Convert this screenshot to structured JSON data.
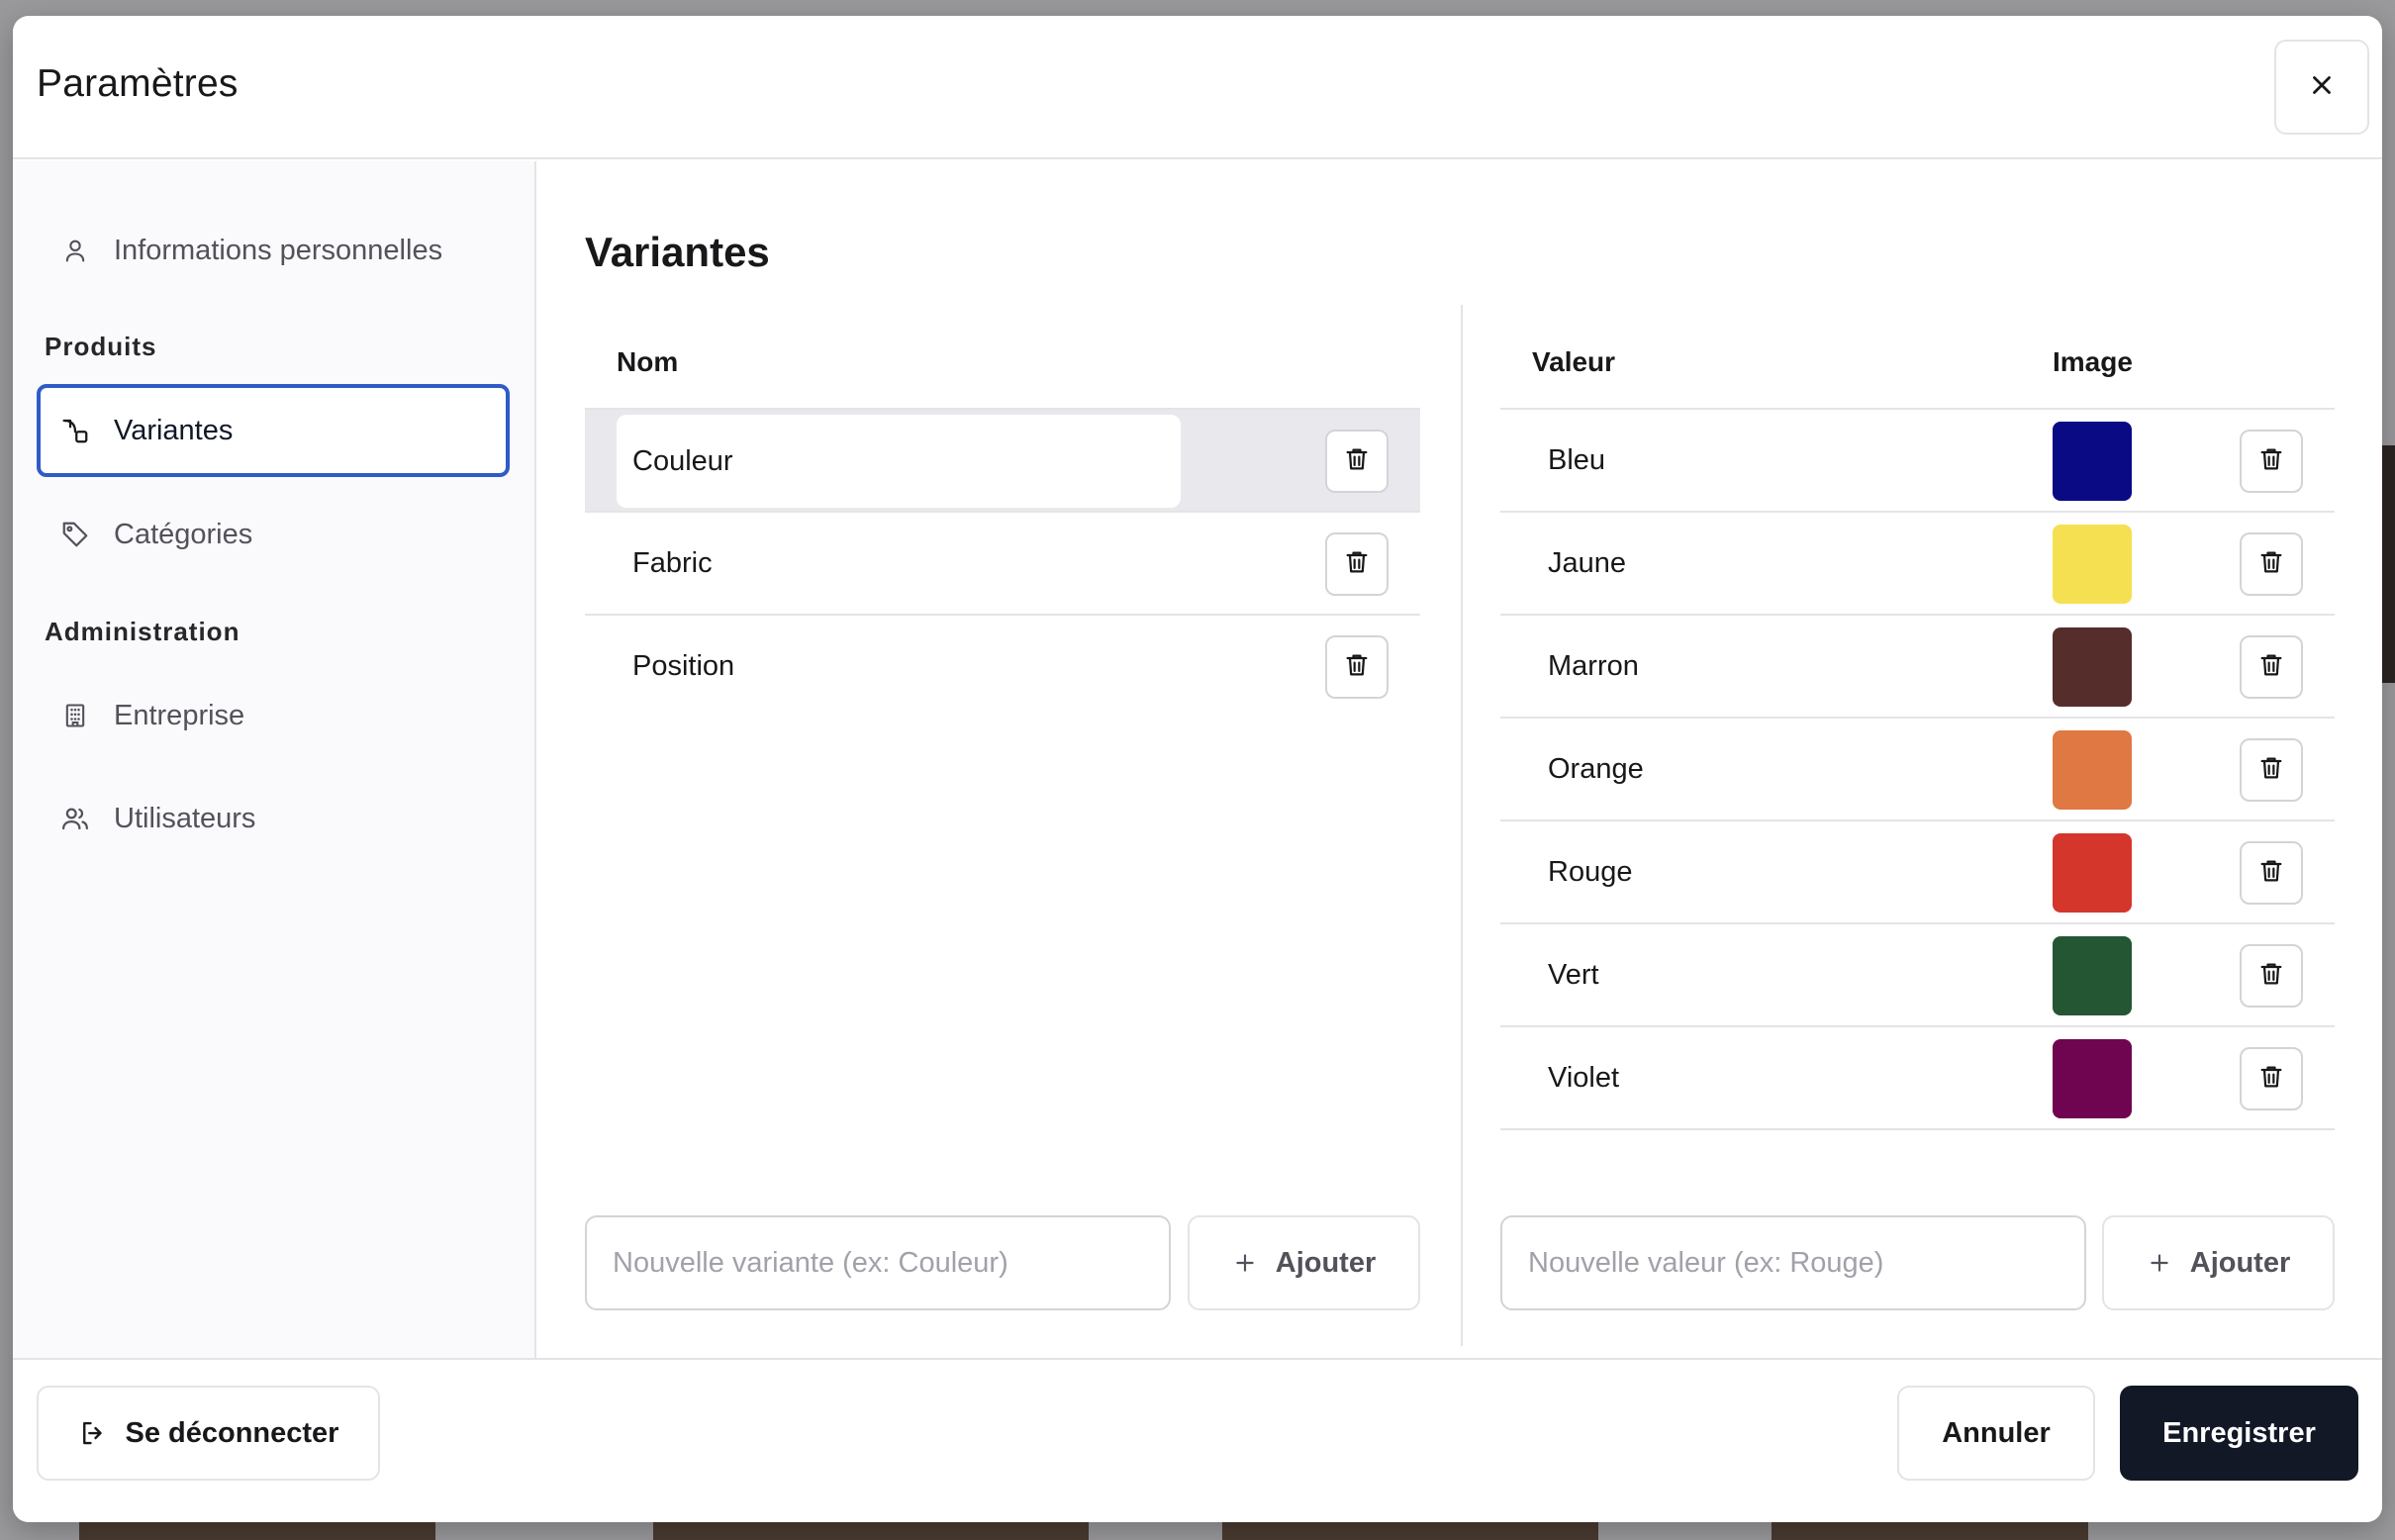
{
  "modal": {
    "title": "Paramètres"
  },
  "sidebar": {
    "items": [
      {
        "label": "Informations personnelles",
        "icon": "user-icon"
      },
      {
        "label": "Variantes",
        "icon": "variants-icon",
        "active": true
      },
      {
        "label": "Catégories",
        "icon": "tag-icon"
      },
      {
        "label": "Entreprise",
        "icon": "building-icon"
      },
      {
        "label": "Utilisateurs",
        "icon": "users-icon"
      }
    ],
    "sections": {
      "products": "Produits",
      "admin": "Administration"
    }
  },
  "content": {
    "title": "Variantes",
    "variants": {
      "header": "Nom",
      "rows": [
        {
          "name": "Couleur",
          "selected": true
        },
        {
          "name": "Fabric"
        },
        {
          "name": "Position"
        }
      ],
      "placeholder": "Nouvelle variante (ex: Couleur)",
      "add_label": "Ajouter"
    },
    "values": {
      "header_value": "Valeur",
      "header_image": "Image",
      "rows": [
        {
          "value": "Bleu",
          "color": "#0a0a85"
        },
        {
          "value": "Jaune",
          "color": "#f5e052"
        },
        {
          "value": "Marron",
          "color": "#552d2b"
        },
        {
          "value": "Orange",
          "color": "#e07843"
        },
        {
          "value": "Rouge",
          "color": "#d5362c"
        },
        {
          "value": "Vert",
          "color": "#245634"
        },
        {
          "value": "Violet",
          "color": "#6f0550"
        }
      ],
      "placeholder": "Nouvelle valeur (ex: Rouge)",
      "add_label": "Ajouter"
    }
  },
  "footer": {
    "logout": "Se déconnecter",
    "cancel": "Annuler",
    "save": "Enregistrer"
  }
}
